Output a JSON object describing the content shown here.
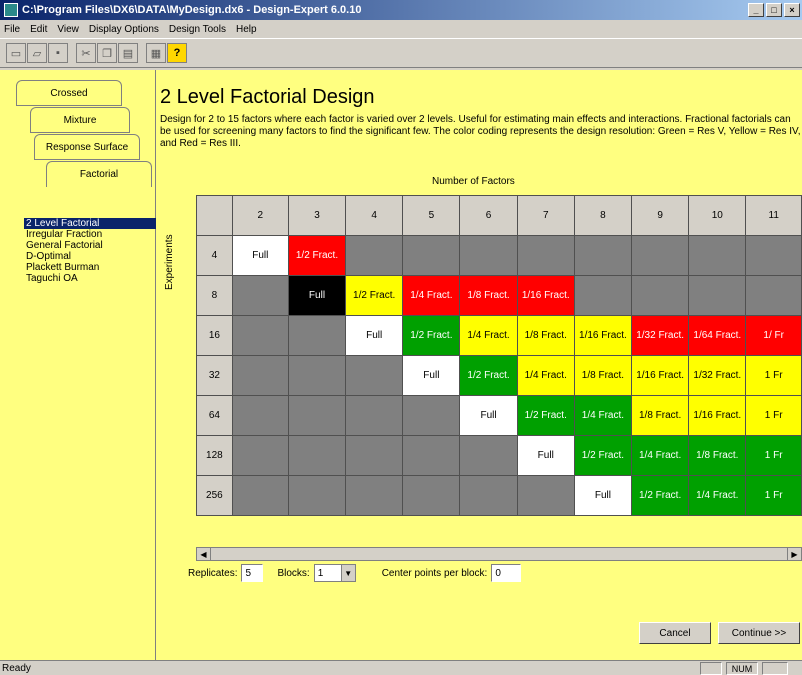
{
  "window": {
    "title": "C:\\Program Files\\DX6\\DATA\\MyDesign.dx6 - Design-Expert 6.0.10"
  },
  "menu": [
    "File",
    "Edit",
    "View",
    "Display Options",
    "Design Tools",
    "Help"
  ],
  "tabs": [
    "Crossed",
    "Mixture",
    "Response Surface",
    "Factorial"
  ],
  "design_list": [
    "2 Level Factorial",
    "Irregular Fraction",
    "General Factorial",
    "D-Optimal",
    "Plackett Burman",
    "Taguchi OA"
  ],
  "page_title": "2 Level Factorial Design",
  "description": "Design for 2 to 15 factors where each factor is varied over 2 levels.  Useful for estimating main effects and interactions.  Fractional factorials can be used for screening many factors to find the significant few. The color coding represents the design resolution: Green = Res V, Yellow = Res IV, and Red = Res III.",
  "grid": {
    "x_title": "Number of Factors",
    "y_title": "Experiments",
    "factors": [
      "2",
      "3",
      "4",
      "5",
      "6",
      "7",
      "8",
      "9",
      "10",
      "11"
    ],
    "rows": [
      {
        "runs": "4",
        "cells": [
          [
            "Full",
            "full"
          ],
          [
            "1/2 Fract.",
            "red"
          ],
          [
            "",
            "gray"
          ],
          [
            "",
            "gray"
          ],
          [
            "",
            "gray"
          ],
          [
            "",
            "gray"
          ],
          [
            "",
            "gray"
          ],
          [
            "",
            "gray"
          ],
          [
            "",
            "gray"
          ],
          [
            "",
            "gray"
          ]
        ]
      },
      {
        "runs": "8",
        "cells": [
          [
            "",
            "gray"
          ],
          [
            "Full",
            "black"
          ],
          [
            "1/2 Fract.",
            "yellow"
          ],
          [
            "1/4 Fract.",
            "red"
          ],
          [
            "1/8 Fract.",
            "red"
          ],
          [
            "1/16 Fract.",
            "red"
          ],
          [
            "",
            "gray"
          ],
          [
            "",
            "gray"
          ],
          [
            "",
            "gray"
          ],
          [
            "",
            "gray"
          ]
        ]
      },
      {
        "runs": "16",
        "cells": [
          [
            "",
            "gray"
          ],
          [
            "",
            "gray"
          ],
          [
            "Full",
            "full"
          ],
          [
            "1/2 Fract.",
            "green"
          ],
          [
            "1/4 Fract.",
            "yellow"
          ],
          [
            "1/8 Fract.",
            "yellow"
          ],
          [
            "1/16 Fract.",
            "yellow"
          ],
          [
            "1/32 Fract.",
            "red"
          ],
          [
            "1/64 Fract.",
            "red"
          ],
          [
            "1/ Fr",
            "red"
          ]
        ]
      },
      {
        "runs": "32",
        "cells": [
          [
            "",
            "gray"
          ],
          [
            "",
            "gray"
          ],
          [
            "",
            "gray"
          ],
          [
            "Full",
            "full"
          ],
          [
            "1/2 Fract.",
            "green"
          ],
          [
            "1/4 Fract.",
            "yellow"
          ],
          [
            "1/8 Fract.",
            "yellow"
          ],
          [
            "1/16 Fract.",
            "yellow"
          ],
          [
            "1/32 Fract.",
            "yellow"
          ],
          [
            "1 Fr",
            "yellow"
          ]
        ]
      },
      {
        "runs": "64",
        "cells": [
          [
            "",
            "gray"
          ],
          [
            "",
            "gray"
          ],
          [
            "",
            "gray"
          ],
          [
            "",
            "gray"
          ],
          [
            "Full",
            "full"
          ],
          [
            "1/2 Fract.",
            "green"
          ],
          [
            "1/4 Fract.",
            "green"
          ],
          [
            "1/8 Fract.",
            "yellow"
          ],
          [
            "1/16 Fract.",
            "yellow"
          ],
          [
            "1 Fr",
            "yellow"
          ]
        ]
      },
      {
        "runs": "128",
        "cells": [
          [
            "",
            "gray"
          ],
          [
            "",
            "gray"
          ],
          [
            "",
            "gray"
          ],
          [
            "",
            "gray"
          ],
          [
            "",
            "gray"
          ],
          [
            "Full",
            "full"
          ],
          [
            "1/2 Fract.",
            "green"
          ],
          [
            "1/4 Fract.",
            "green"
          ],
          [
            "1/8 Fract.",
            "green"
          ],
          [
            "1 Fr",
            "green"
          ]
        ]
      },
      {
        "runs": "256",
        "cells": [
          [
            "",
            "gray"
          ],
          [
            "",
            "gray"
          ],
          [
            "",
            "gray"
          ],
          [
            "",
            "gray"
          ],
          [
            "",
            "gray"
          ],
          [
            "",
            "gray"
          ],
          [
            "Full",
            "full"
          ],
          [
            "1/2 Fract.",
            "green"
          ],
          [
            "1/4 Fract.",
            "green"
          ],
          [
            "1 Fr",
            "green"
          ]
        ]
      }
    ]
  },
  "options": {
    "replicates_label": "Replicates:",
    "replicates_value": "5",
    "blocks_label": "Blocks:",
    "blocks_value": "1",
    "center_label": "Center points per block:",
    "center_value": "0"
  },
  "buttons": {
    "cancel": "Cancel",
    "continue": "Continue >>"
  },
  "status": {
    "text": "Ready",
    "num": "NUM"
  }
}
